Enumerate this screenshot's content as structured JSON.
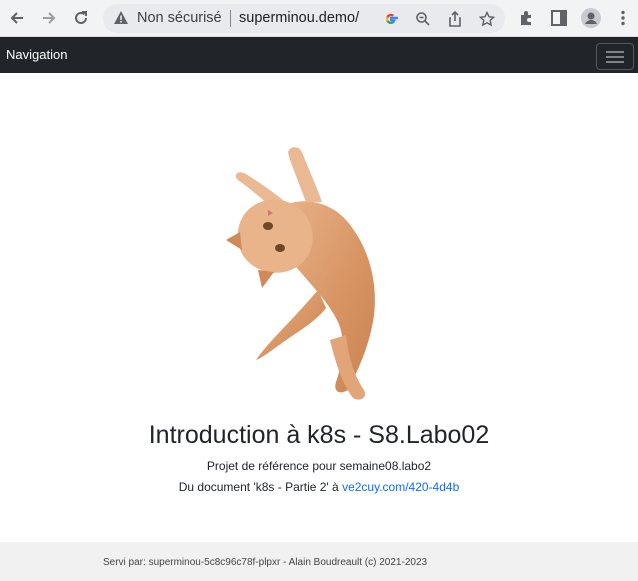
{
  "browser": {
    "security_label": "Non sécurisé",
    "url": "superminou.demo/",
    "icons": [
      "back-arrow-icon",
      "forward-arrow-icon",
      "reload-icon",
      "warning-icon",
      "google-icon",
      "zoom-icon",
      "share-icon",
      "bookmark-star-icon",
      "extensions-icon",
      "side-panel-icon",
      "profile-icon",
      "menu-dots-icon"
    ]
  },
  "navbar": {
    "brand": "Navigation"
  },
  "main": {
    "image": "cat-image",
    "title": "Introduction à k8s - S8.Labo02",
    "subtitle": "Projet de référence pour semaine08.labo2",
    "doc_prefix": "Du document 'k8s - Partie 2' à ",
    "doc_link": "ve2cuy.com/420-4d4b"
  },
  "footer": {
    "text": "Servi par: superminou-5c8c96c78f-plpxr - Alain Boudreault (c) 2021-2023"
  },
  "colors": {
    "navbar": "#212529",
    "link": "#0d6efd",
    "footer_bg": "#f1f1f1"
  }
}
